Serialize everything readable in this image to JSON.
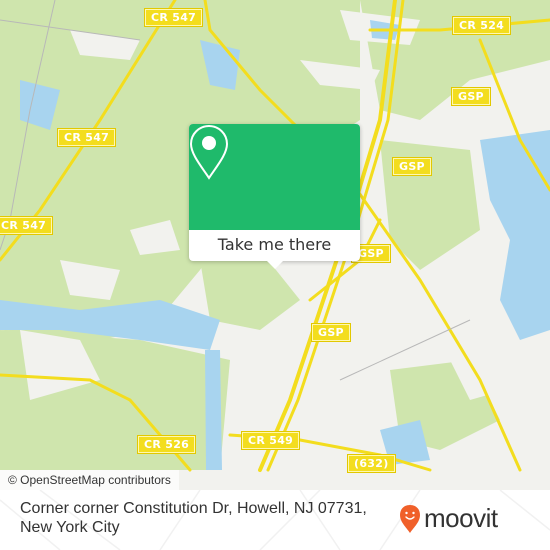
{
  "map": {
    "attribution": "© OpenStreetMap contributors",
    "road_labels": [
      {
        "id": "cr547-top",
        "text": "CR 547"
      },
      {
        "id": "cr547-mid",
        "text": "CR 547"
      },
      {
        "id": "cr547-left",
        "text": "CR 547"
      },
      {
        "id": "cr524",
        "text": "CR 524"
      },
      {
        "id": "gsp-1",
        "text": "GSP"
      },
      {
        "id": "gsp-2",
        "text": "GSP"
      },
      {
        "id": "gsp-3",
        "text": "GSP"
      },
      {
        "id": "gsp-4",
        "text": "GSP"
      },
      {
        "id": "cr526",
        "text": "CR 526"
      },
      {
        "id": "cr549",
        "text": "CR 549"
      },
      {
        "id": "r632",
        "text": "(632)"
      }
    ],
    "colors": {
      "land": "#f2f2ee",
      "forest": "#cfe5ad",
      "water": "#a8d4ef",
      "road": "#f3dd1e"
    }
  },
  "popup": {
    "icon": "map-pin-icon",
    "button_label": "Take me there",
    "color": "#1fba6b"
  },
  "footer": {
    "address": "Corner corner Constitution Dr, Howell, NJ 07731, New York City",
    "brand": "moovit",
    "brand_icon": "moovit-pin-smile-icon",
    "brand_color": "#f0602a"
  }
}
